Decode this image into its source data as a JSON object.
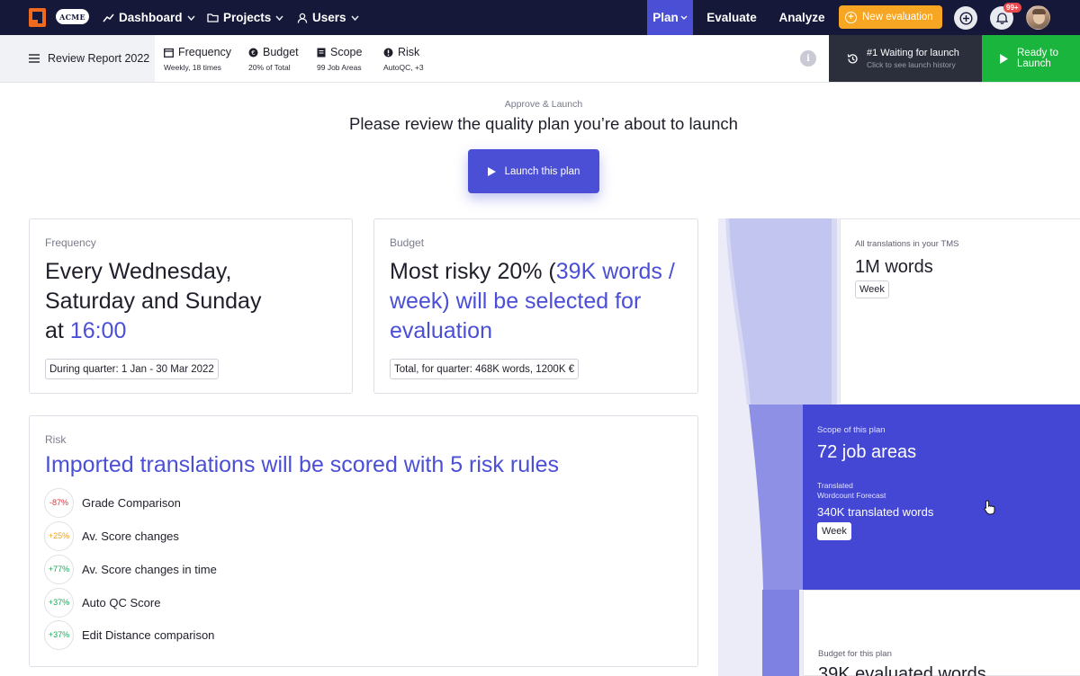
{
  "nav": {
    "brand": "ACME",
    "links": [
      "Dashboard",
      "Projects",
      "Users"
    ],
    "right": {
      "plan": "Plan",
      "evaluate": "Evaluate",
      "analyze": "Analyze"
    },
    "new_evaluation": "New evaluation",
    "notifications_badge": "99+"
  },
  "subbar": {
    "report": "Review Report 2022",
    "frequency": {
      "title": "Frequency",
      "sub": "Weekly, 18 times"
    },
    "budget": {
      "title": "Budget",
      "sub": "20% of Total"
    },
    "scope": {
      "title": "Scope",
      "sub": "99 Job Areas"
    },
    "risk": {
      "title": "Risk",
      "sub": "AutoQC, +3"
    },
    "info": "i",
    "waiting": {
      "title": "#1 Waiting for launch",
      "sub": "Click to see launch history"
    },
    "ready": {
      "line1": "Ready to",
      "line2": "Launch"
    }
  },
  "hero": {
    "eyebrow": "Approve & Launch",
    "headline": "Please review the quality plan you’re about to launch",
    "launch_button": "Launch this plan"
  },
  "frequency_card": {
    "label": "Frequency",
    "line1": "Every Wednesday,",
    "line2": "Saturday and Sunday",
    "line3_prefix": "at ",
    "time": "16:00",
    "pill": "During quarter: 1 Jan - 30 Mar 2022"
  },
  "budget_card": {
    "label": "Budget",
    "prefix": "Most risky 20% (",
    "accent": "39K words / week) will be selected for evaluation",
    "pill": "Total, for quarter: 468K words, 1200K €"
  },
  "risk_card": {
    "label": "Risk",
    "headline": "Imported translations will be scored with 5 risk rules",
    "rules": [
      {
        "change": "-87%",
        "name": "Grade Comparison",
        "color": "#d9363e"
      },
      {
        "change": "+25%",
        "name": "Av. Score changes",
        "color": "#f0a020"
      },
      {
        "change": "+77%",
        "name": "Av. Score changes in time",
        "color": "#1ea65b"
      },
      {
        "change": "+37%",
        "name": "Auto QC Score",
        "color": "#1ea65b"
      },
      {
        "change": "+37%",
        "name": "Edit Distance comparison",
        "color": "#1ea65b"
      }
    ]
  },
  "funnel": {
    "all": {
      "label": "All translations in your TMS",
      "value": "1M words",
      "chip": "Week"
    },
    "scope": {
      "label": "Scope of this plan",
      "value": "72 job areas",
      "sub1": "Translated",
      "sub2": "Wordcount Forecast",
      "forecast": "340K translated words",
      "chip": "Week"
    },
    "budget": {
      "label": "Budget for this plan",
      "value": "39K evaluated words"
    }
  },
  "colors": {
    "nav_bg": "#151838",
    "accent": "#4a4fd6",
    "orange": "#f6a623",
    "green": "#1ab53c"
  }
}
